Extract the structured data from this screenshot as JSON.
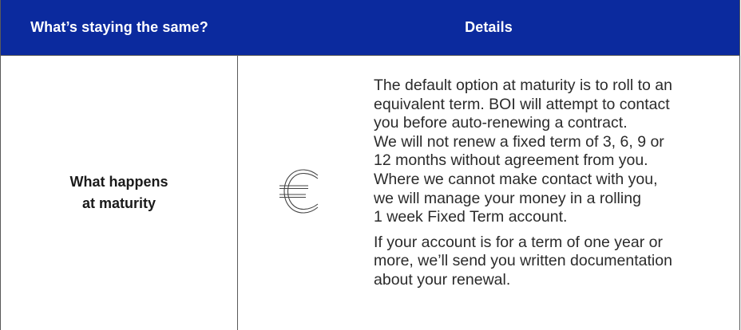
{
  "header": {
    "col1": "What’s staying the same?",
    "col2": "Details"
  },
  "row": {
    "label_lines": [
      "What happens",
      "at maturity"
    ],
    "icon": "euro-icon",
    "paragraphs": [
      [
        "The default option at maturity is to roll to an",
        "equivalent term. BOI will attempt to contact",
        "you before auto-renewing a contract.",
        "We will not renew a fixed term of 3, 6, 9 or",
        "12 months without agreement from you.",
        "Where we cannot make contact with you,",
        "we will manage your money in a rolling",
        "1 week Fixed Term account."
      ],
      [
        "If your account is for a term of one year or",
        "more, we’ll send you written documentation",
        "about your renewal."
      ]
    ]
  },
  "colors": {
    "header_bg": "#0b2a9e",
    "header_text": "#ffffff",
    "border": "#5a5a5a",
    "body_text": "#2b2b2b"
  }
}
